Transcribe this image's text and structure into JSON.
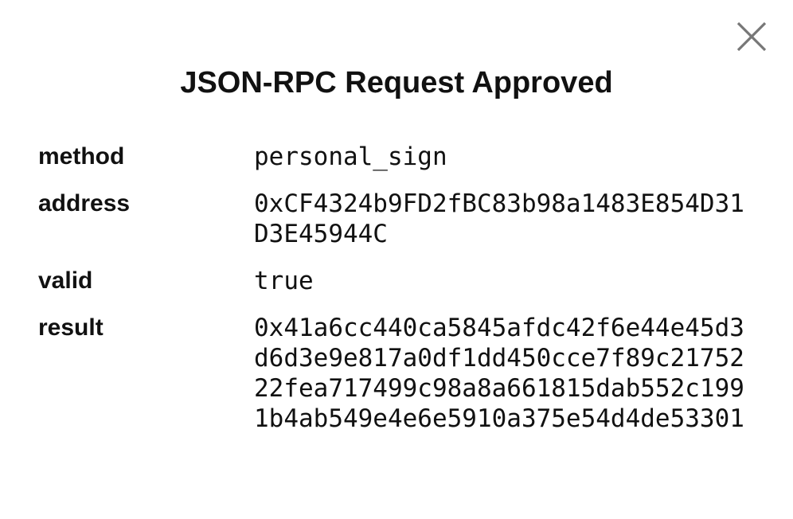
{
  "dialog": {
    "title": "JSON-RPC Request Approved",
    "close_icon": "close-icon"
  },
  "rows": [
    {
      "key": "method",
      "value": "personal_sign"
    },
    {
      "key": "address",
      "value": "0xCF4324b9FD2fBC83b98a1483E854D31D3E45944C"
    },
    {
      "key": "valid",
      "value": "true"
    },
    {
      "key": "result",
      "value": "0x41a6cc440ca5845afdc42f6e44e45d3d6d3e9e817a0df1dd450cce7f89c2175222fea717499c98a8a661815dab552c1991b4ab549e4e6e5910a375e54d4de53301"
    }
  ],
  "colors": {
    "text": "#111111",
    "close_icon": "#777777",
    "background": "#ffffff"
  }
}
